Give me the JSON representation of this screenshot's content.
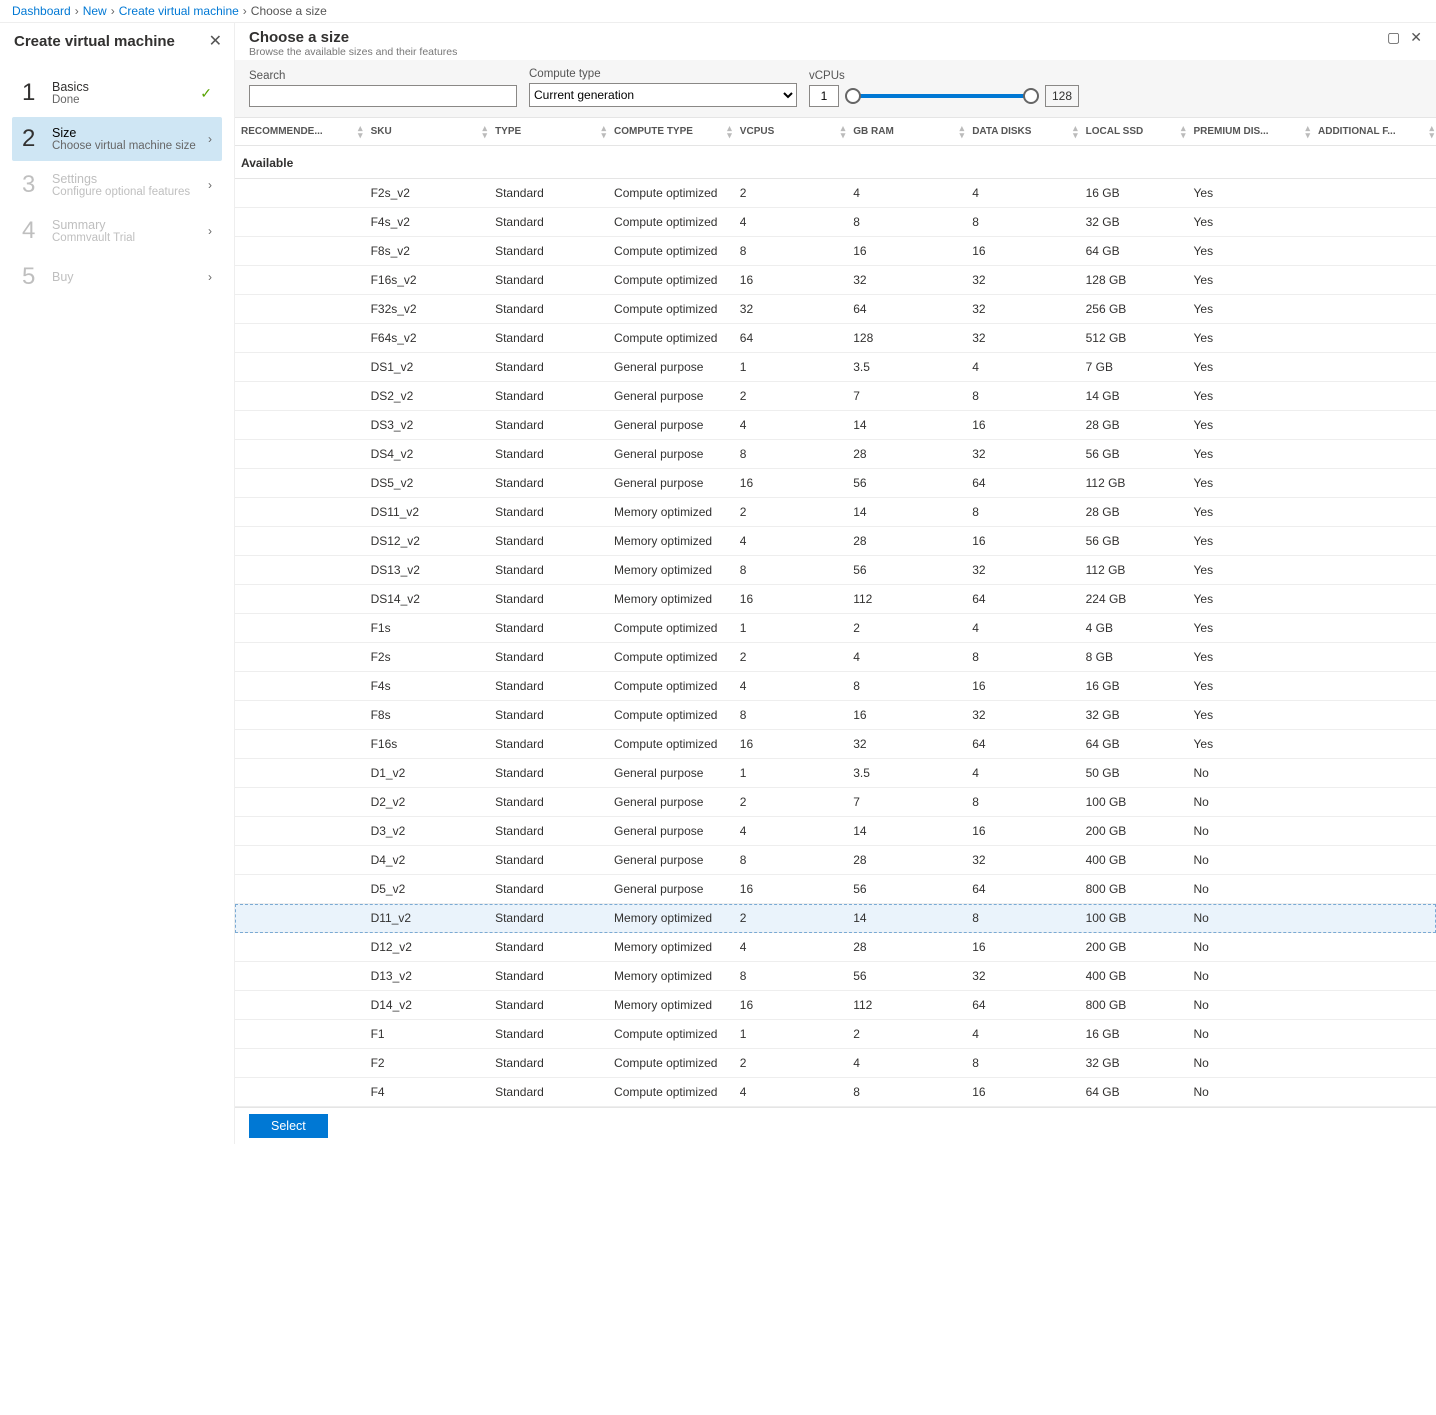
{
  "breadcrumb": {
    "items": [
      "Dashboard",
      "New",
      "Create virtual machine"
    ],
    "current": "Choose a size"
  },
  "left": {
    "title": "Create virtual machine",
    "steps": [
      {
        "title": "Basics",
        "sub": "Done",
        "state": "done"
      },
      {
        "title": "Size",
        "sub": "Choose virtual machine size",
        "state": "active"
      },
      {
        "title": "Settings",
        "sub": "Configure optional features",
        "state": "future"
      },
      {
        "title": "Summary",
        "sub": "Commvault Trial",
        "state": "future"
      },
      {
        "title": "Buy",
        "sub": "",
        "state": "future"
      }
    ]
  },
  "header": {
    "title": "Choose a size",
    "sub": "Browse the available sizes and their features"
  },
  "filters": {
    "search_label": "Search",
    "search_value": "",
    "compute_label": "Compute type",
    "compute_value": "Current generation",
    "vcpus_label": "vCPUs",
    "vcpus_min": "1",
    "vcpus_max": "128"
  },
  "columns": [
    "RECOMMENDE...",
    "SKU",
    "TYPE",
    "COMPUTE TYPE",
    "VCPUS",
    "GB RAM",
    "DATA DISKS",
    "LOCAL SSD",
    "PREMIUM DIS...",
    "ADDITIONAL F..."
  ],
  "group": "Available",
  "rows": [
    {
      "sku": "F2s_v2",
      "type": "Standard",
      "ctype": "Compute optimized",
      "vcpu": "2",
      "ram": "4",
      "dd": "4",
      "ssd": "16 GB",
      "prem": "Yes"
    },
    {
      "sku": "F4s_v2",
      "type": "Standard",
      "ctype": "Compute optimized",
      "vcpu": "4",
      "ram": "8",
      "dd": "8",
      "ssd": "32 GB",
      "prem": "Yes"
    },
    {
      "sku": "F8s_v2",
      "type": "Standard",
      "ctype": "Compute optimized",
      "vcpu": "8",
      "ram": "16",
      "dd": "16",
      "ssd": "64 GB",
      "prem": "Yes"
    },
    {
      "sku": "F16s_v2",
      "type": "Standard",
      "ctype": "Compute optimized",
      "vcpu": "16",
      "ram": "32",
      "dd": "32",
      "ssd": "128 GB",
      "prem": "Yes"
    },
    {
      "sku": "F32s_v2",
      "type": "Standard",
      "ctype": "Compute optimized",
      "vcpu": "32",
      "ram": "64",
      "dd": "32",
      "ssd": "256 GB",
      "prem": "Yes"
    },
    {
      "sku": "F64s_v2",
      "type": "Standard",
      "ctype": "Compute optimized",
      "vcpu": "64",
      "ram": "128",
      "dd": "32",
      "ssd": "512 GB",
      "prem": "Yes"
    },
    {
      "sku": "DS1_v2",
      "type": "Standard",
      "ctype": "General purpose",
      "vcpu": "1",
      "ram": "3.5",
      "dd": "4",
      "ssd": "7 GB",
      "prem": "Yes"
    },
    {
      "sku": "DS2_v2",
      "type": "Standard",
      "ctype": "General purpose",
      "vcpu": "2",
      "ram": "7",
      "dd": "8",
      "ssd": "14 GB",
      "prem": "Yes"
    },
    {
      "sku": "DS3_v2",
      "type": "Standard",
      "ctype": "General purpose",
      "vcpu": "4",
      "ram": "14",
      "dd": "16",
      "ssd": "28 GB",
      "prem": "Yes"
    },
    {
      "sku": "DS4_v2",
      "type": "Standard",
      "ctype": "General purpose",
      "vcpu": "8",
      "ram": "28",
      "dd": "32",
      "ssd": "56 GB",
      "prem": "Yes"
    },
    {
      "sku": "DS5_v2",
      "type": "Standard",
      "ctype": "General purpose",
      "vcpu": "16",
      "ram": "56",
      "dd": "64",
      "ssd": "112 GB",
      "prem": "Yes"
    },
    {
      "sku": "DS11_v2",
      "type": "Standard",
      "ctype": "Memory optimized",
      "vcpu": "2",
      "ram": "14",
      "dd": "8",
      "ssd": "28 GB",
      "prem": "Yes"
    },
    {
      "sku": "DS12_v2",
      "type": "Standard",
      "ctype": "Memory optimized",
      "vcpu": "4",
      "ram": "28",
      "dd": "16",
      "ssd": "56 GB",
      "prem": "Yes"
    },
    {
      "sku": "DS13_v2",
      "type": "Standard",
      "ctype": "Memory optimized",
      "vcpu": "8",
      "ram": "56",
      "dd": "32",
      "ssd": "112 GB",
      "prem": "Yes"
    },
    {
      "sku": "DS14_v2",
      "type": "Standard",
      "ctype": "Memory optimized",
      "vcpu": "16",
      "ram": "112",
      "dd": "64",
      "ssd": "224 GB",
      "prem": "Yes"
    },
    {
      "sku": "F1s",
      "type": "Standard",
      "ctype": "Compute optimized",
      "vcpu": "1",
      "ram": "2",
      "dd": "4",
      "ssd": "4 GB",
      "prem": "Yes"
    },
    {
      "sku": "F2s",
      "type": "Standard",
      "ctype": "Compute optimized",
      "vcpu": "2",
      "ram": "4",
      "dd": "8",
      "ssd": "8 GB",
      "prem": "Yes"
    },
    {
      "sku": "F4s",
      "type": "Standard",
      "ctype": "Compute optimized",
      "vcpu": "4",
      "ram": "8",
      "dd": "16",
      "ssd": "16 GB",
      "prem": "Yes"
    },
    {
      "sku": "F8s",
      "type": "Standard",
      "ctype": "Compute optimized",
      "vcpu": "8",
      "ram": "16",
      "dd": "32",
      "ssd": "32 GB",
      "prem": "Yes"
    },
    {
      "sku": "F16s",
      "type": "Standard",
      "ctype": "Compute optimized",
      "vcpu": "16",
      "ram": "32",
      "dd": "64",
      "ssd": "64 GB",
      "prem": "Yes"
    },
    {
      "sku": "D1_v2",
      "type": "Standard",
      "ctype": "General purpose",
      "vcpu": "1",
      "ram": "3.5",
      "dd": "4",
      "ssd": "50 GB",
      "prem": "No"
    },
    {
      "sku": "D2_v2",
      "type": "Standard",
      "ctype": "General purpose",
      "vcpu": "2",
      "ram": "7",
      "dd": "8",
      "ssd": "100 GB",
      "prem": "No"
    },
    {
      "sku": "D3_v2",
      "type": "Standard",
      "ctype": "General purpose",
      "vcpu": "4",
      "ram": "14",
      "dd": "16",
      "ssd": "200 GB",
      "prem": "No"
    },
    {
      "sku": "D4_v2",
      "type": "Standard",
      "ctype": "General purpose",
      "vcpu": "8",
      "ram": "28",
      "dd": "32",
      "ssd": "400 GB",
      "prem": "No"
    },
    {
      "sku": "D5_v2",
      "type": "Standard",
      "ctype": "General purpose",
      "vcpu": "16",
      "ram": "56",
      "dd": "64",
      "ssd": "800 GB",
      "prem": "No"
    },
    {
      "sku": "D11_v2",
      "type": "Standard",
      "ctype": "Memory optimized",
      "vcpu": "2",
      "ram": "14",
      "dd": "8",
      "ssd": "100 GB",
      "prem": "No",
      "selected": true
    },
    {
      "sku": "D12_v2",
      "type": "Standard",
      "ctype": "Memory optimized",
      "vcpu": "4",
      "ram": "28",
      "dd": "16",
      "ssd": "200 GB",
      "prem": "No"
    },
    {
      "sku": "D13_v2",
      "type": "Standard",
      "ctype": "Memory optimized",
      "vcpu": "8",
      "ram": "56",
      "dd": "32",
      "ssd": "400 GB",
      "prem": "No"
    },
    {
      "sku": "D14_v2",
      "type": "Standard",
      "ctype": "Memory optimized",
      "vcpu": "16",
      "ram": "112",
      "dd": "64",
      "ssd": "800 GB",
      "prem": "No"
    },
    {
      "sku": "F1",
      "type": "Standard",
      "ctype": "Compute optimized",
      "vcpu": "1",
      "ram": "2",
      "dd": "4",
      "ssd": "16 GB",
      "prem": "No"
    },
    {
      "sku": "F2",
      "type": "Standard",
      "ctype": "Compute optimized",
      "vcpu": "2",
      "ram": "4",
      "dd": "8",
      "ssd": "32 GB",
      "prem": "No"
    },
    {
      "sku": "F4",
      "type": "Standard",
      "ctype": "Compute optimized",
      "vcpu": "4",
      "ram": "8",
      "dd": "16",
      "ssd": "64 GB",
      "prem": "No"
    }
  ],
  "footer": {
    "select": "Select"
  }
}
